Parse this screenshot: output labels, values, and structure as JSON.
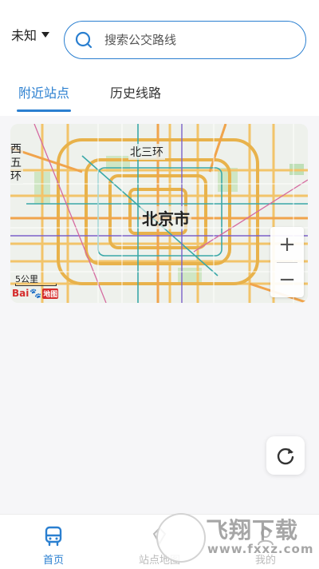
{
  "header": {
    "city": "未知",
    "search": {
      "placeholder": "搜索公交路线",
      "value": ""
    }
  },
  "tabs": [
    {
      "label": "附近站点",
      "active": true
    },
    {
      "label": "历史线路",
      "active": false
    }
  ],
  "map": {
    "labels": {
      "west_fifth_ring": "西五环",
      "north_third_ring": "北三环",
      "city": "北京市"
    },
    "scale": "5公里",
    "logo_text": "Bai",
    "logo_suffix": "地图",
    "zoom_in": "+",
    "zoom_out": "−"
  },
  "refresh": {
    "icon": "refresh-icon"
  },
  "bottom_nav": [
    {
      "label": "首页",
      "icon": "bus-icon",
      "active": true
    },
    {
      "label": "站点地图",
      "icon": "map-icon",
      "active": false
    },
    {
      "label": "我的",
      "icon": "user-icon",
      "active": false
    }
  ],
  "watermark": {
    "text": "飞翔下载",
    "url": "www.fxxz.com"
  },
  "colors": {
    "accent": "#2a7fd0",
    "road_major": "#f2c46a",
    "road_ring": "#e8b24b",
    "metro": "#3aa8a8"
  }
}
